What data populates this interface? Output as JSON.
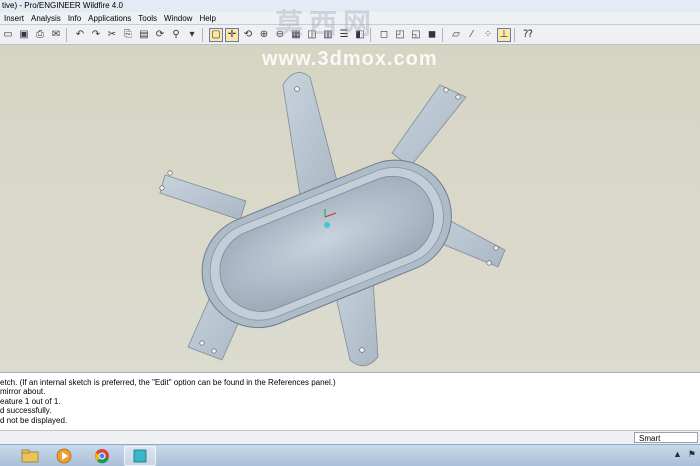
{
  "window": {
    "title": "tive) - Pro/ENGINEER Wildfire 4.0"
  },
  "menu": {
    "items": [
      "Insert",
      "Analysis",
      "Info",
      "Applications",
      "Tools",
      "Window",
      "Help"
    ]
  },
  "watermark": {
    "chinese": "莫西网",
    "url": "www.3dmox.com"
  },
  "messages": [
    "etch. (If an internal sketch is preferred, the \"Edit\" option can be found in the References panel.)",
    "mirror about.",
    "eature 1 out of 1.",
    "d successfully.",
    "d not be displayed."
  ],
  "status": {
    "filter": "Smart"
  },
  "colors": {
    "part": "#b9c6d2",
    "viewport_bg": "#d6d5c3",
    "accent": "#3a6fb0"
  },
  "toolbar_icons": [
    "open-folder-icon",
    "save-icon",
    "print-icon",
    "email-icon",
    "undo-icon",
    "redo-icon",
    "cut-icon",
    "copy-icon",
    "paste-icon",
    "regenerate-icon",
    "find-icon",
    "select-icon",
    "repaint-icon",
    "spin-center-icon",
    "orient-icon",
    "zoom-in-icon",
    "zoom-out-icon",
    "refit-icon",
    "reorient-icon",
    "saved-views-icon",
    "layers-icon",
    "view-manager-icon",
    "wireframe-icon",
    "hidden-line-icon",
    "no-hidden-icon",
    "shading-icon",
    "datum-planes-icon",
    "datum-axes-icon",
    "datum-points-icon",
    "csys-icon",
    "context-help-icon"
  ],
  "taskbar_icons": [
    "file-explorer-icon",
    "media-player-icon",
    "chrome-icon",
    "proengineer-icon"
  ]
}
